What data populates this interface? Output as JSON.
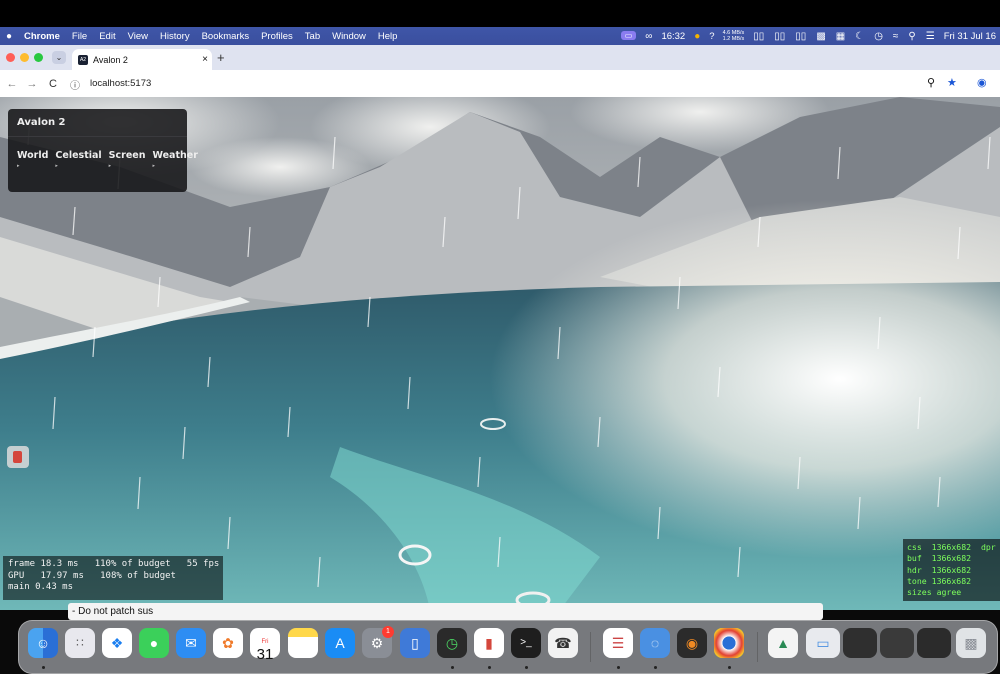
{
  "menubar": {
    "apple": "",
    "app_name": "Chrome",
    "items": [
      "File",
      "Edit",
      "View",
      "History",
      "Bookmarks",
      "Profiles",
      "Tab",
      "Window",
      "Help"
    ],
    "clock": "16:32",
    "net_up": "4.6 MB/s",
    "net_down": "1.2 MB/s",
    "question": "?",
    "date": "Fri 31 Jul 16"
  },
  "tabs": [
    {
      "title": "Avalon 2",
      "close": "×"
    }
  ],
  "new_tab": "+",
  "toolbar": {
    "back": "←",
    "forward": "→",
    "reload": "C",
    "url": "localhost:5173"
  },
  "gui": {
    "title": "Avalon 2",
    "folders": [
      {
        "label": "World",
        "arrow": "▸"
      },
      {
        "label": "Celestial",
        "arrow": "▸"
      },
      {
        "label": "Screen",
        "arrow": "▸"
      },
      {
        "label": "Weather",
        "arrow": "▸"
      }
    ]
  },
  "perf": {
    "line1": "frame 18.3 ms   110% of budget   55 fps",
    "line2": "GPU   17.97 ms   108% of budget",
    "line3": "main 0.43 ms"
  },
  "debug": {
    "css": "css  1366x682  dpr",
    "buf": "buf  1366x682",
    "hdr": "hdr  1366x682",
    "tone": "tone 1366x682",
    "sizes": "sizes agree"
  },
  "terminal": {
    "line1": "- Do not patch sus​"
  },
  "dock": {
    "calendar_month": "Fri",
    "calendar_day": "31",
    "settings_badge": "1",
    "terminal_glyph": ">_",
    "items": [
      "finder",
      "launchpad",
      "safari",
      "messages",
      "mail",
      "photos",
      "calendar",
      "notes",
      "app-store",
      "system-settings",
      "simulator",
      "activity-monitor",
      "avalon",
      "terminal",
      "voice-memos",
      "textedit",
      "db-browser",
      "blender",
      "chrome",
      "preview",
      "downloads",
      "trash"
    ]
  },
  "colors": {
    "menubar": "#3a4f9e",
    "tabstrip": "#dfe3f0",
    "perf_text": "#f2f2f2",
    "debug_text": "#7dff5c"
  }
}
